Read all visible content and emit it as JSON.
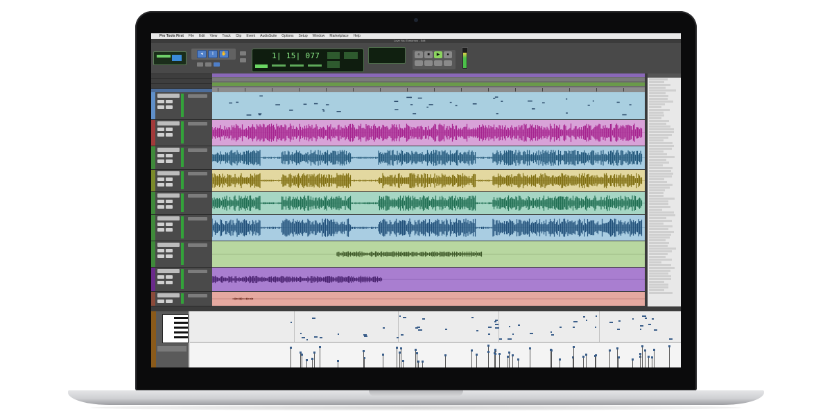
{
  "app": {
    "menubar": {
      "apple_symbol": "",
      "items": [
        "Pro Tools First",
        "File",
        "Edit",
        "View",
        "Track",
        "Clip",
        "Event",
        "AudioSuite",
        "Options",
        "Setup",
        "Window",
        "Marketplace",
        "Help"
      ]
    },
    "window_title": "Love You Tomorrow - Edit",
    "counter": {
      "main_time": "1| 15| 077",
      "sub_line": "",
      "small_counter": ""
    },
    "tracks": [
      {
        "type": "midi",
        "color": "#5f8fc9",
        "lane_color": "#a9cfe0",
        "wave_color": "#2b4a6a"
      },
      {
        "type": "audio",
        "color": "#a23a3a",
        "lane_color": "#d8a2d8",
        "wave_color": "#a6238f"
      },
      {
        "type": "audio",
        "color": "#3f8a3a",
        "lane_color": "#a9cde2",
        "wave_color": "#22577a"
      },
      {
        "type": "audio",
        "color": "#7a8a2a",
        "lane_color": "#e3d8a0",
        "wave_color": "#7f6e10"
      },
      {
        "type": "audio",
        "color": "#3f8a3a",
        "lane_color": "#a6d6c4",
        "wave_color": "#1f6e52"
      },
      {
        "type": "audio",
        "color": "#3f8a3a",
        "lane_color": "#a9cde2",
        "wave_color": "#21507a"
      },
      {
        "type": "audio",
        "color": "#3f8a3a",
        "lane_color": "#b8d7a0",
        "wave_color": "#3f5a2a"
      },
      {
        "type": "audio",
        "color": "#6a2a8a",
        "lane_color": "#a97ed0",
        "wave_color": "#4a2370"
      },
      {
        "type": "audio",
        "color": "#8a4a3a",
        "lane_color": "#e5a9a0",
        "wave_color": "#7a3a30"
      }
    ],
    "colors": {
      "accent_blue": "#4f7fc8",
      "lcd_green": "#8ff08a",
      "play_green": "#8bd45e"
    }
  }
}
